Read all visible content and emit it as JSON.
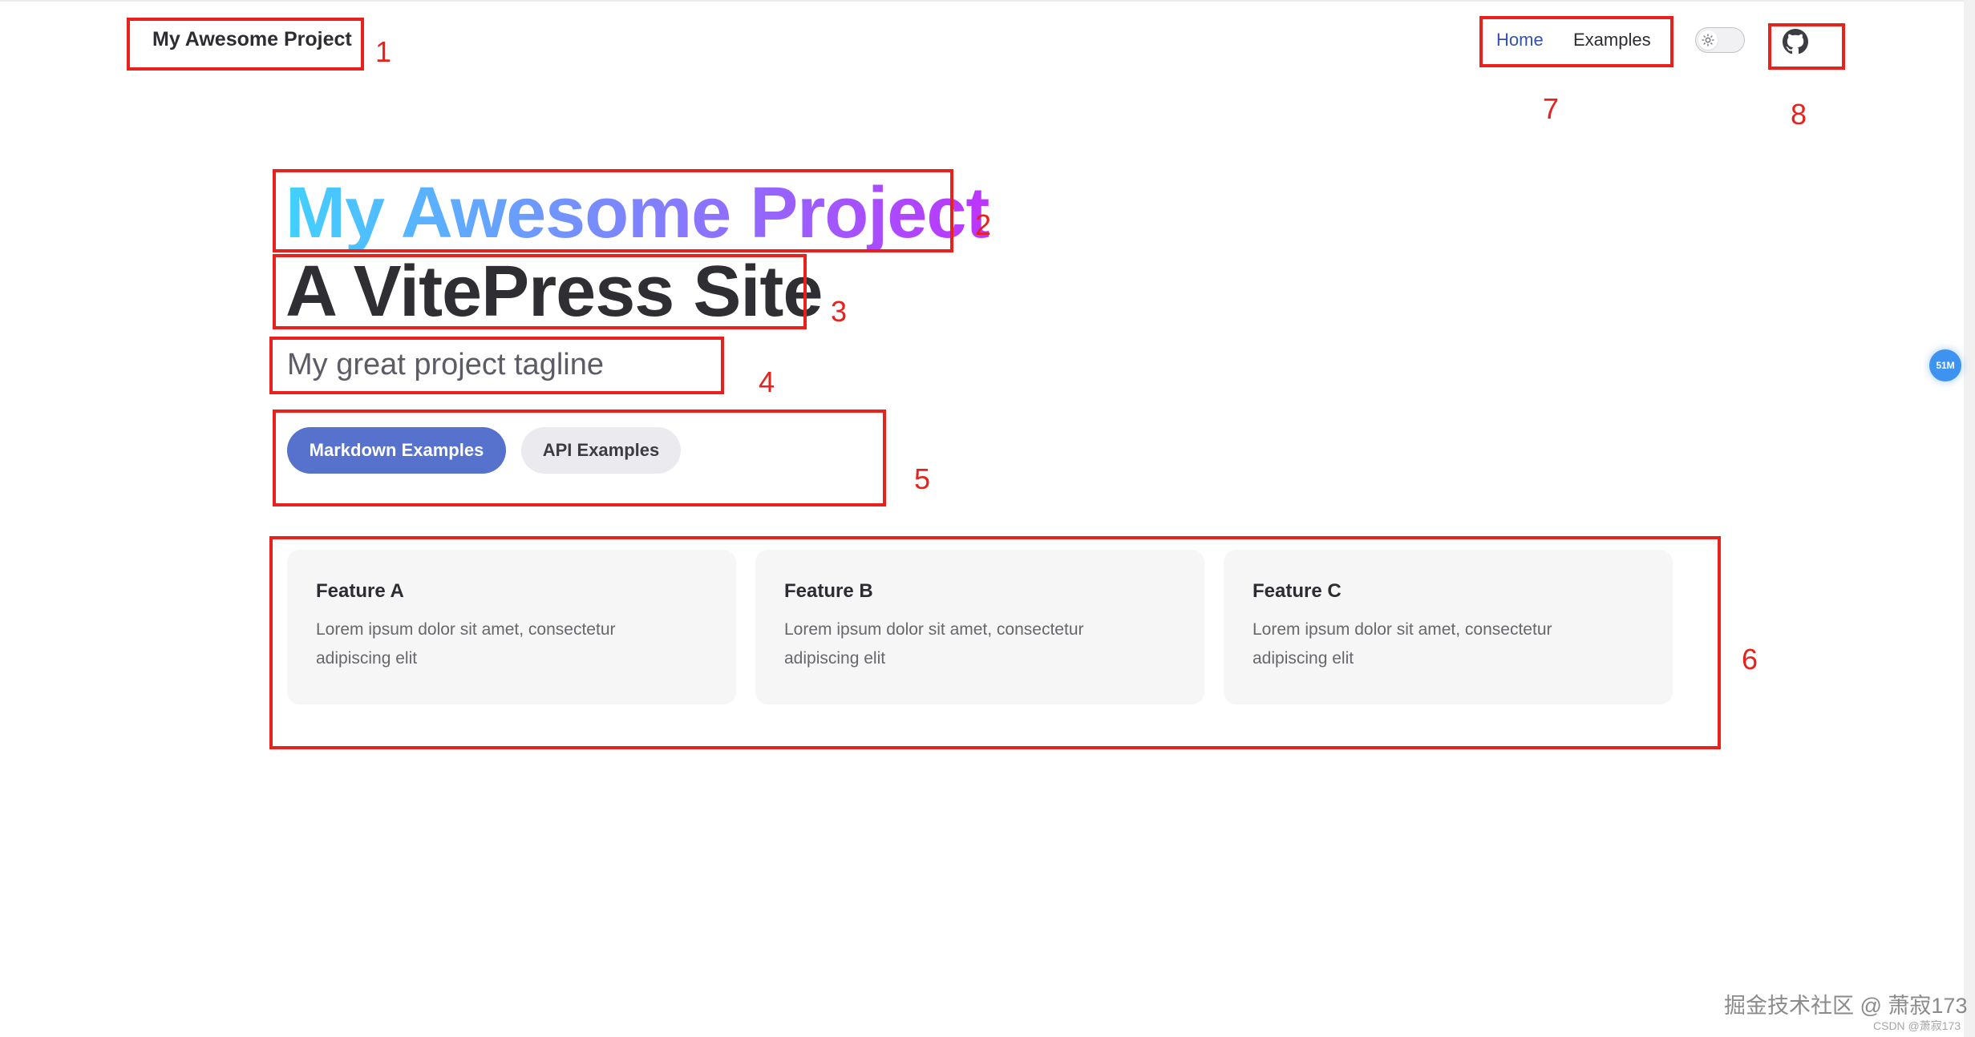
{
  "nav": {
    "site_title": "My Awesome Project",
    "links": [
      {
        "label": "Home",
        "active": true
      },
      {
        "label": "Examples",
        "active": false
      }
    ],
    "theme_switch_icon": "sun-icon",
    "social_icon": "github-icon"
  },
  "hero": {
    "name": "My Awesome Project",
    "text": "A VitePress Site",
    "tagline": "My great project tagline",
    "actions": [
      {
        "label": "Markdown Examples",
        "theme": "brand"
      },
      {
        "label": "API Examples",
        "theme": "alt"
      }
    ],
    "name_gradient": [
      "#41d1ff",
      "#bd34fe"
    ]
  },
  "features": [
    {
      "title": "Feature A",
      "details": "Lorem ipsum dolor sit amet, consectetur adipiscing elit"
    },
    {
      "title": "Feature B",
      "details": "Lorem ipsum dolor sit amet, consectetur adipiscing elit"
    },
    {
      "title": "Feature C",
      "details": "Lorem ipsum dolor sit amet, consectetur adipiscing elit"
    }
  ],
  "annotations": [
    "1",
    "2",
    "3",
    "4",
    "5",
    "6",
    "7",
    "8"
  ],
  "floating_badge": "51M",
  "watermark": {
    "main": "掘金技术社区 @ 萧寂173",
    "sub": "CSDN @萧寂173"
  },
  "colors": {
    "brand": "#5672cd",
    "nav_active": "#3451b2",
    "annotation": "#e8211c",
    "feature_bg": "#f6f6f7"
  }
}
